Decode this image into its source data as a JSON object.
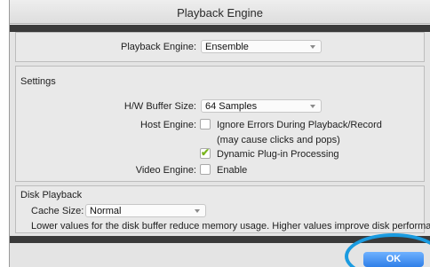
{
  "window": {
    "title": "Playback Engine"
  },
  "engine": {
    "label": "Playback Engine:",
    "value": "Ensemble"
  },
  "settings": {
    "heading": "Settings",
    "buffer_label": "H/W Buffer Size:",
    "buffer_value": "64 Samples",
    "host_label": "Host Engine:",
    "ignore_errors_label": "Ignore Errors During Playback/Record",
    "ignore_errors_note": "(may cause clicks and pops)",
    "ignore_errors_checked": false,
    "dynamic_label": "Dynamic Plug-in Processing",
    "dynamic_checked": true,
    "video_label": "Video Engine:",
    "video_enable_label": "Enable",
    "video_checked": false
  },
  "disk": {
    "heading": "Disk Playback",
    "cache_label": "Cache Size:",
    "cache_value": "Normal",
    "note": "Lower values for the disk buffer reduce memory usage.  Higher values improve disk performance."
  },
  "footer": {
    "ok_label": "OK"
  },
  "colors": {
    "ok_button": "#3a8cf0",
    "highlight_circle": "#1a9be0",
    "checkmark": "#7ab51d"
  }
}
